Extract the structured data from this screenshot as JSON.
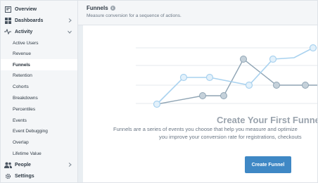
{
  "sidebar": {
    "items": [
      {
        "label": "Overview",
        "icon": "overview-icon"
      },
      {
        "label": "Dashboards",
        "icon": "dashboards-icon"
      },
      {
        "label": "Activity",
        "icon": "activity-icon"
      },
      {
        "label": "Active Users"
      },
      {
        "label": "Revenue"
      },
      {
        "label": "Funnels"
      },
      {
        "label": "Retention"
      },
      {
        "label": "Cohorts"
      },
      {
        "label": "Breakdowns"
      },
      {
        "label": "Percentiles"
      },
      {
        "label": "Events"
      },
      {
        "label": "Event Debugging"
      },
      {
        "label": "Overlap"
      },
      {
        "label": "Lifetime Value"
      },
      {
        "label": "People",
        "icon": "people-icon"
      },
      {
        "label": "Settings",
        "icon": "settings-icon"
      }
    ],
    "active": "Funnels"
  },
  "header": {
    "title": "Funnels",
    "subtitle": "Measure conversion for a sequence of actions."
  },
  "empty_state": {
    "title": "Create Your First Funnel",
    "description_line1": "Funnels are a series of events you choose that help you measure and optimize",
    "description_line2": "you improve your conversion rate for registrations, checkouts",
    "button_label": "Create Funnel"
  },
  "colors": {
    "sidebar_bg": "#f4f6f8",
    "main_bg": "#e9eef2",
    "accent": "#3f88c5",
    "line_light": "#a9d2ef",
    "line_dark": "#8fa4b4"
  }
}
